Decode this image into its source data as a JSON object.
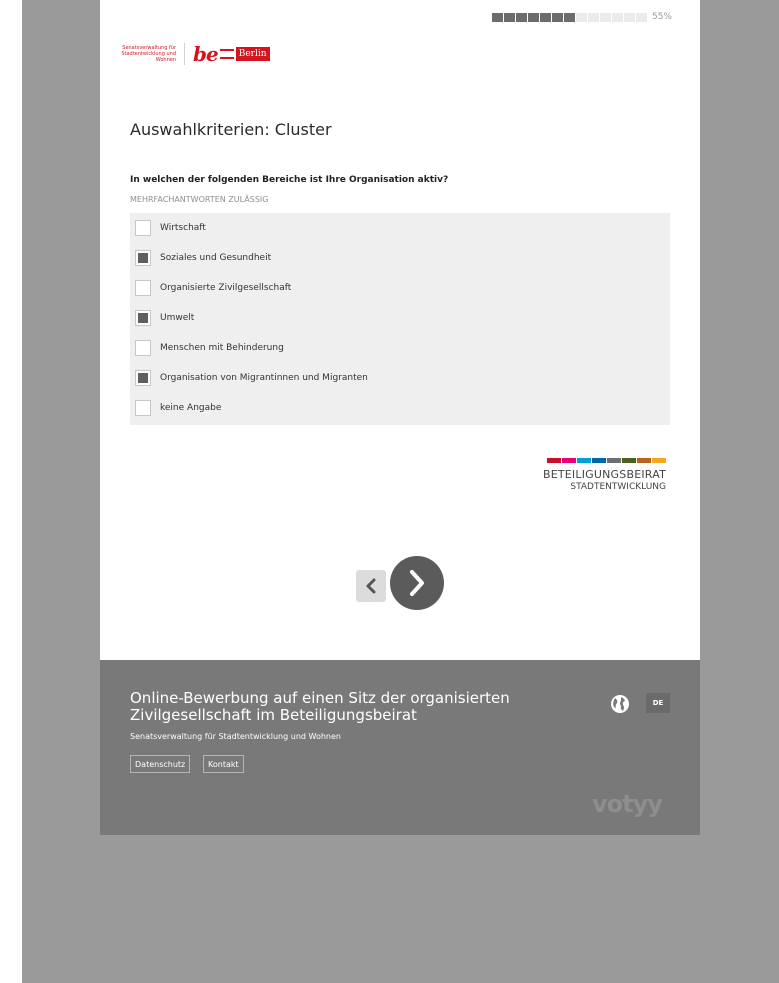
{
  "progress": {
    "percent_label": "55%",
    "segments_total": 13,
    "segments_filled": 7
  },
  "header": {
    "senat_text": "Senatsverwaltung für Stadtentwicklung und Wohnen",
    "be_text": "be",
    "berlin_text": "Berlin",
    "brand_color": "#d4151f"
  },
  "page": {
    "title": "Auswahlkriterien: Cluster",
    "question": "In welchen der folgenden Bereiche ist Ihre Organisation aktiv?",
    "hint": "MEHRFACHANTWORTEN ZULÄSSIG"
  },
  "options": [
    {
      "label": "Wirtschaft",
      "checked": false
    },
    {
      "label": "Soziales und Gesundheit",
      "checked": true
    },
    {
      "label": "Organisierte Zivilgesellschaft",
      "checked": false
    },
    {
      "label": "Umwelt",
      "checked": true
    },
    {
      "label": "Menschen mit Behinderung",
      "checked": false
    },
    {
      "label": "Organisation von Migrantinnen und Migranten",
      "checked": true
    },
    {
      "label": "keine Angabe",
      "checked": false
    }
  ],
  "brand": {
    "line1": "BETEILIGUNGSBEIRAT",
    "line2": "STADTENTWICKLUNG",
    "stripe_colors": [
      "#c8102e",
      "#e4007c",
      "#00a0d2",
      "#0067a5",
      "#6d6e71",
      "#4b5f1e",
      "#b5651d",
      "#f5a623"
    ]
  },
  "nav": {
    "prev_icon": "chevron-left-icon",
    "next_icon": "chevron-right-icon"
  },
  "footer": {
    "title": "Online-Bewerbung auf einen Sitz der organisierten Zivilgesellschaft im Beteiligungsbeirat",
    "subtitle": "Senatsverwaltung für Stadtentwicklung und Wohnen",
    "privacy": "Datenschutz",
    "contact": "Kontakt",
    "language": "DE",
    "language_icon": "globe-icon",
    "provider": "votyy"
  }
}
